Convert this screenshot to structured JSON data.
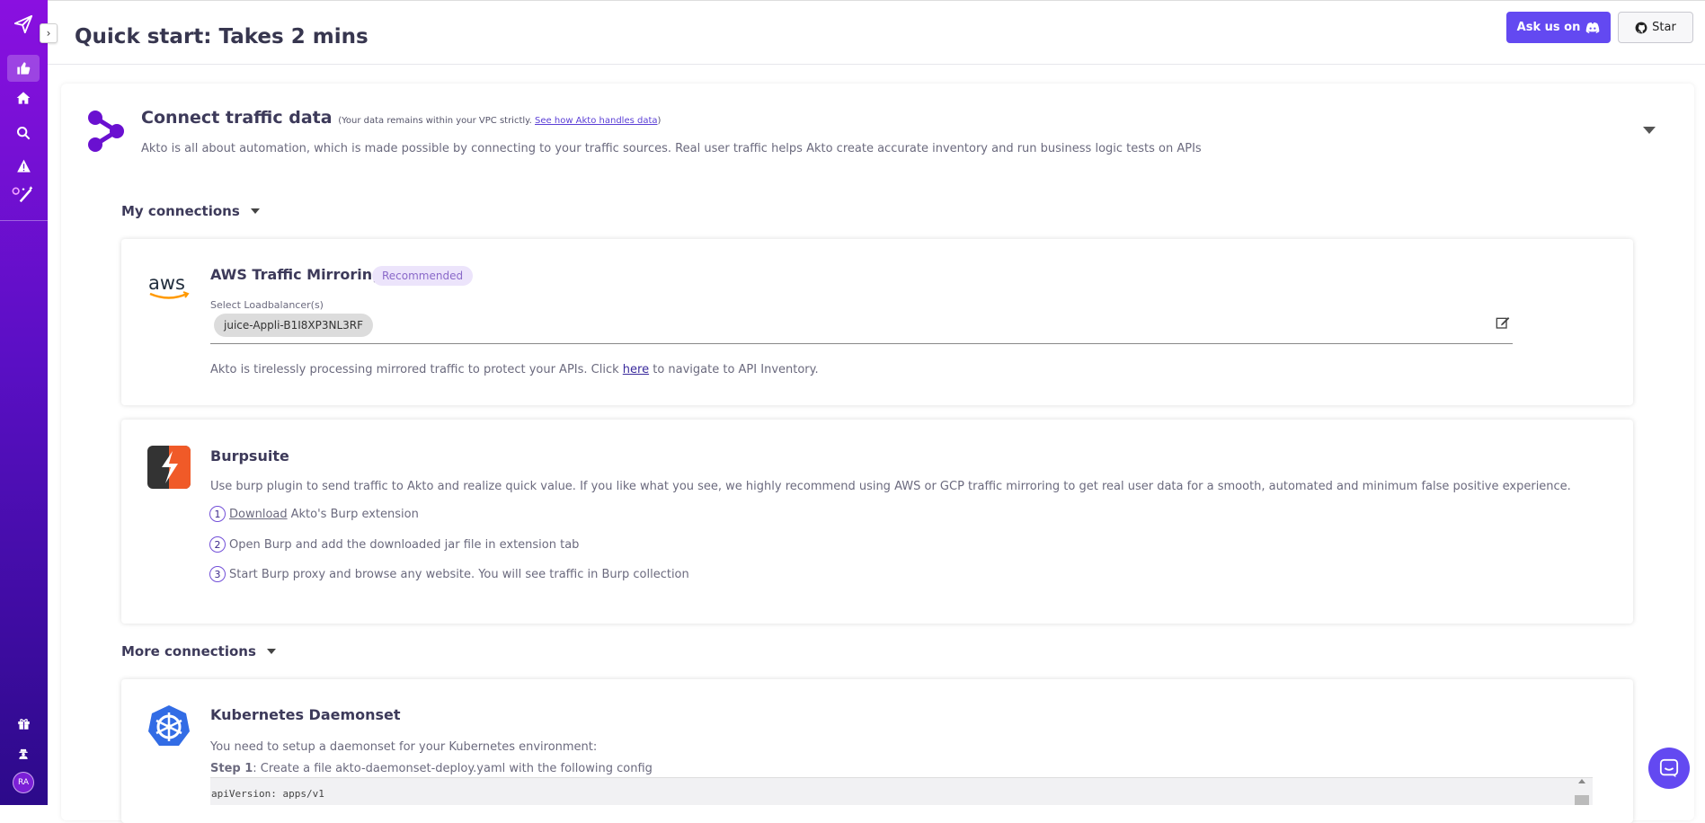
{
  "sidebar": {
    "avatar_initials": "RA",
    "icons": [
      "paper-plane-icon",
      "thumbs-up-icon",
      "home-icon",
      "search-icon",
      "warning-icon",
      "magic-wand-icon",
      "gift-icon",
      "user-secret-icon"
    ]
  },
  "header": {
    "title": "Quick start: Takes 2 mins",
    "ask_label": "Ask us on",
    "star_label": "Star"
  },
  "connect": {
    "title": "Connect traffic data",
    "note_prefix": "(Your data remains within your VPC strictly.",
    "note_link": "See how Akto handles data",
    "note_suffix": ")",
    "description": "Akto is all about automation, which is made possible by connecting to your traffic sources. Real user traffic helps Akto create accurate inventory and run business logic tests on APIs"
  },
  "my_connections": {
    "heading": "My connections"
  },
  "aws": {
    "logo_text": "aws",
    "title": "AWS Traffic Mirroring",
    "badge": "Recommended",
    "select_label": "Select Loadbalancer(s)",
    "chip": "juice-Appli-B1I8XP3NL3RF",
    "status_prefix": "Akto is tirelessly processing mirrored traffic to protect your APIs. Click",
    "status_link": "here",
    "status_suffix": "to navigate to API Inventory."
  },
  "burp": {
    "title": "Burpsuite",
    "description": "Use burp plugin to send traffic to Akto and realize quick value. If you like what you see, we highly recommend using AWS or GCP traffic mirroring to get real user data for a smooth, automated and minimum false positive experience.",
    "steps": [
      {
        "num": "1",
        "link": "Download",
        "text": "Akto's Burp extension"
      },
      {
        "num": "2",
        "text": "Open Burp and add the downloaded jar file in extension tab"
      },
      {
        "num": "3",
        "text": "Start Burp proxy and browse any website. You will see traffic in Burp collection"
      }
    ]
  },
  "more_connections": {
    "heading": "More connections"
  },
  "k8s": {
    "title": "Kubernetes Daemonset",
    "description": "You need to setup a daemonset for your Kubernetes environment:",
    "step1_bold": "Step 1",
    "step1_text": ": Create a file akto-daemonset-deploy.yaml with the following config",
    "code_line": "apiVersion: apps/v1"
  },
  "colors": {
    "sidebar_top": "#8a10e0",
    "sidebar_bottom": "#2c0a8a",
    "accent": "#6349f1",
    "badge_bg": "#ece4fb"
  }
}
